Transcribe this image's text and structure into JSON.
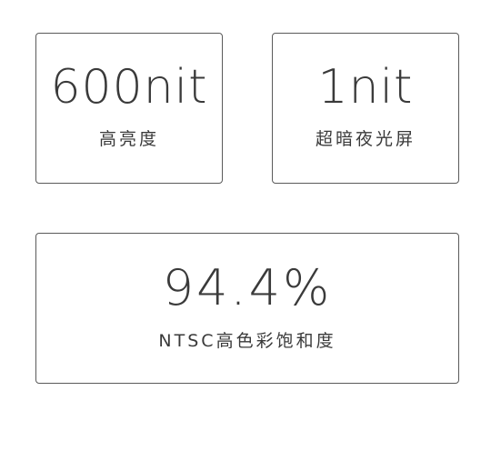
{
  "cards": [
    {
      "value": "600nit",
      "label": "高亮度"
    },
    {
      "value": "1nit",
      "label": "超暗夜光屏"
    },
    {
      "value": "94.4%",
      "label": "NTSC高色彩饱和度"
    }
  ]
}
